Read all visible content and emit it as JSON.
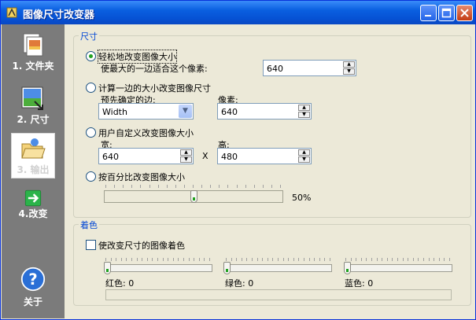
{
  "window": {
    "title": "图像尺寸改变器"
  },
  "sidebar": {
    "items": [
      {
        "label": "1. 文件夹",
        "icon": "folder-files-icon"
      },
      {
        "label": "2. 尺寸",
        "icon": "resize-image-icon"
      },
      {
        "label": "3. 输出",
        "icon": "output-folder-icon"
      },
      {
        "label": "4.改变",
        "icon": "arrow-right-icon"
      },
      {
        "label": "关于",
        "icon": "help-icon"
      }
    ]
  },
  "size_group": {
    "legend": "尺寸",
    "option_easy": {
      "label": "轻松地改变图像大小",
      "sub_label": "使最大的一边适合这个像素:",
      "pixels": "640"
    },
    "option_side": {
      "label": "计算一边的大小改变图像尺寸",
      "side_label": "预先确定的边:",
      "side_value": "Width",
      "pixels_label": "像素:",
      "pixels": "640"
    },
    "option_custom": {
      "label": "用户自定义改变图像大小",
      "width_label": "宽:",
      "width": "640",
      "times": "X",
      "height_label": "高:",
      "height": "480"
    },
    "option_percent": {
      "label": "按百分比改变图像大小",
      "percent_text": "50%",
      "percent": 50
    }
  },
  "color_group": {
    "legend": "着色",
    "checkbox_label": "使改变尺寸的图像着色",
    "red_label": "红色: 0",
    "green_label": "绿色: 0",
    "blue_label": "蓝色: 0",
    "red": 0,
    "green": 0,
    "blue": 0
  },
  "colors": {
    "title_blue": "#0a5fe0",
    "legend_blue": "#0046d5",
    "sidebar_gray": "#7b7b7b",
    "radio_green": "#21a121"
  }
}
